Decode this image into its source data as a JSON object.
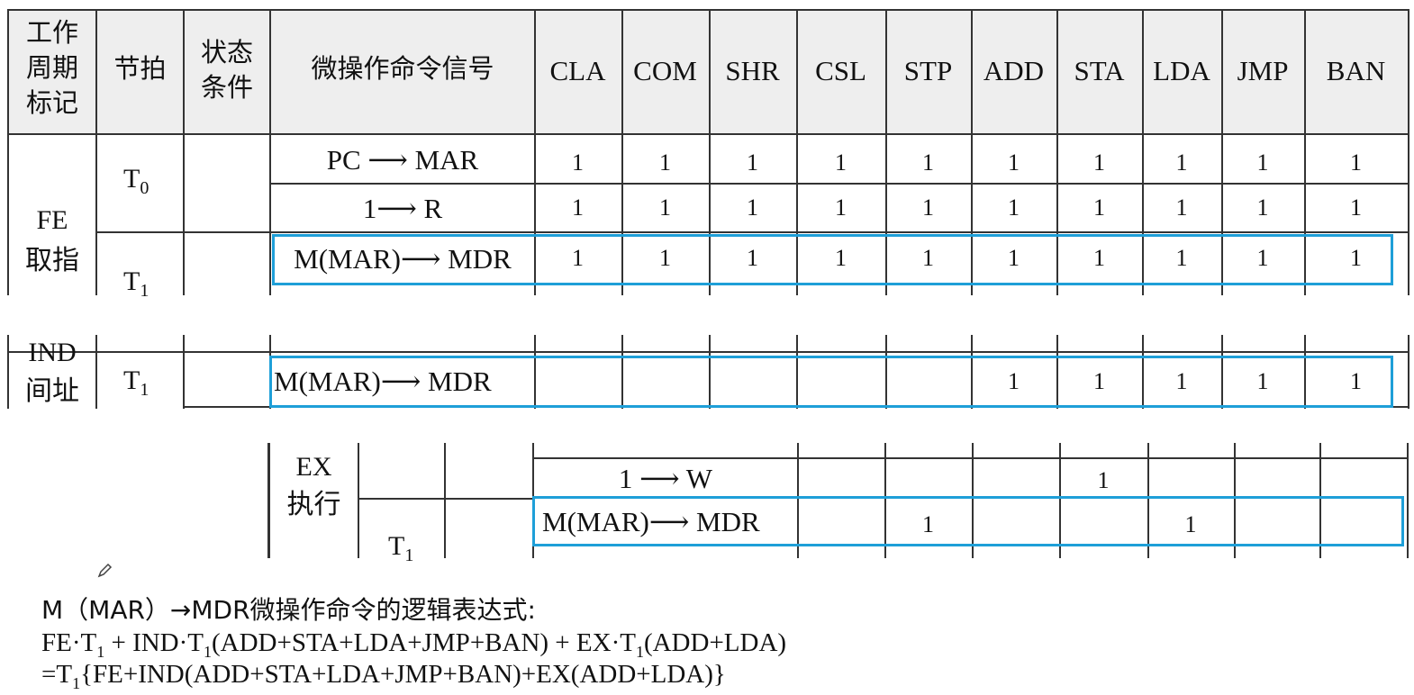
{
  "header": {
    "col1": [
      "工作",
      "周期",
      "标记"
    ],
    "col2": "节拍",
    "col3": [
      "状态",
      "条件"
    ],
    "col4": "微操作命令信号",
    "instructions": [
      "CLA",
      "COM",
      "SHR",
      "CSL",
      "STP",
      "ADD",
      "STA",
      "LDA",
      "JMP",
      "BAN"
    ]
  },
  "fe": {
    "label_en": "FE",
    "label_cn": "取指",
    "t0": "T",
    "t0_sub": "0",
    "t1": "T",
    "t1_sub": "1",
    "rows": [
      {
        "op": "PC ⟶ MAR",
        "values": [
          "1",
          "1",
          "1",
          "1",
          "1",
          "1",
          "1",
          "1",
          "1",
          "1"
        ]
      },
      {
        "op": "1⟶ R",
        "values": [
          "1",
          "1",
          "1",
          "1",
          "1",
          "1",
          "1",
          "1",
          "1",
          "1"
        ]
      },
      {
        "op": "M(MAR)⟶ MDR",
        "values": [
          "1",
          "1",
          "1",
          "1",
          "1",
          "1",
          "1",
          "1",
          "1",
          "1"
        ]
      }
    ]
  },
  "ind": {
    "label_en": "IND",
    "label_cn": "间址",
    "t1": "T",
    "t1_sub": "1",
    "row": {
      "op": "M(MAR)⟶ MDR",
      "values": [
        "",
        "",
        "",
        "",
        "",
        "1",
        "1",
        "1",
        "1",
        "1"
      ]
    }
  },
  "ex": {
    "label_en": "EX",
    "label_cn": "执行",
    "t1": "T",
    "t1_sub": "1",
    "rows": [
      {
        "op": "1 ⟶ W",
        "values": [
          "",
          "",
          "",
          "",
          "",
          "",
          "1",
          "",
          "",
          ""
        ]
      },
      {
        "op": "M(MAR)⟶ MDR",
        "values": [
          "",
          "",
          "",
          "",
          "1",
          "",
          "",
          "1",
          "",
          ""
        ]
      }
    ]
  },
  "formula": {
    "line1": "M（MAR）→MDR微操作命令的逻辑表达式:",
    "line2_a": "FE·T",
    "line2_sub1": "1",
    "line2_b": " + IND·T",
    "line2_sub2": "1",
    "line2_c": "(ADD+STA+LDA+JMP+BAN) + EX·T",
    "line2_sub3": "1",
    "line2_d": "(ADD+LDA)",
    "line3_a": "=T",
    "line3_sub": "1",
    "line3_b": "{FE+IND(ADD+STA+LDA+JMP+BAN)+EX(ADD+LDA)}"
  },
  "colors": {
    "highlight": "#1e9fd8",
    "header_bg": "#eeeeee"
  }
}
